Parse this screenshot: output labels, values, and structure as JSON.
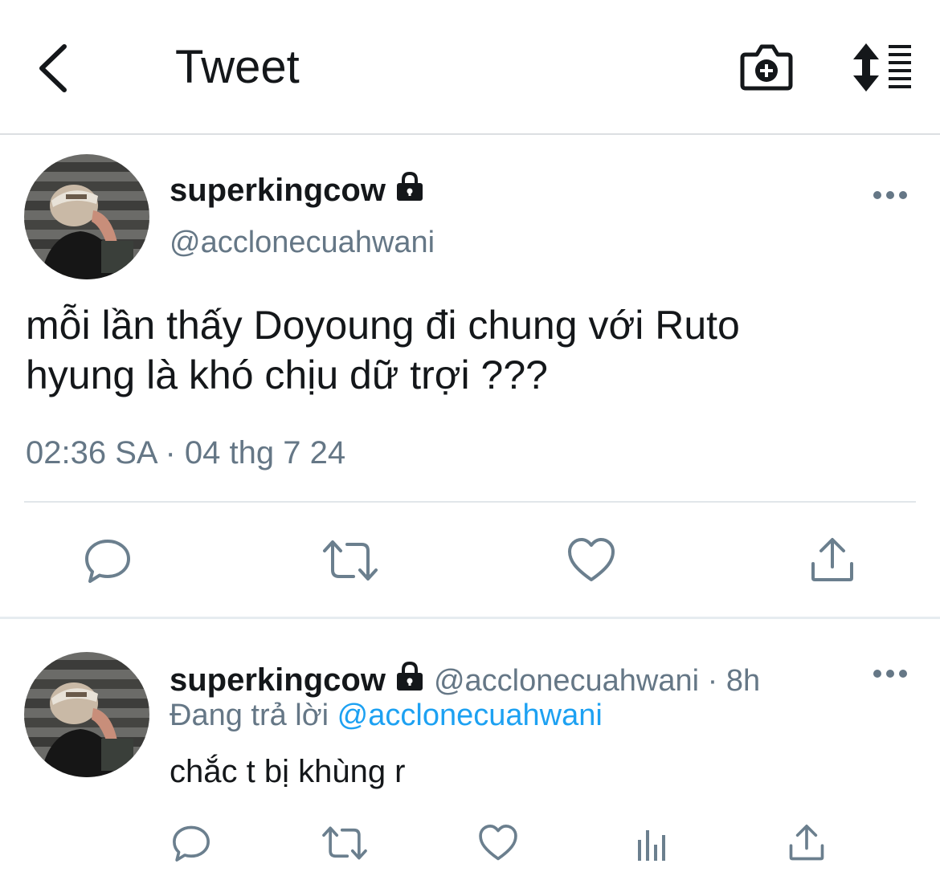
{
  "nav": {
    "title": "Tweet"
  },
  "tweet": {
    "display_name": "superkingcow",
    "handle": "@acclonecuahwani",
    "text_line1": "mỗi lần thấy Doyoung đi chung với Ruto",
    "text_line2": "hyung là khó chịu dữ trợi ???",
    "timestamp": "02:36 SA · 04 thg 7 24",
    "actions": [
      "reply-icon",
      "retweet-icon",
      "like-icon",
      "share-icon"
    ]
  },
  "reply": {
    "display_name": "superkingcow",
    "handle_time": "@acclonecuahwani · 8h",
    "replying_label": "Đang trả lời",
    "replying_to": "@acclonecuahwani",
    "text": "chắc t bị khùng r",
    "actions": [
      "reply-icon",
      "retweet-icon",
      "like-icon",
      "analytics-icon",
      "share-icon"
    ]
  },
  "colors": {
    "text": "#14171a",
    "secondary": "#657786",
    "accent": "#1da1f2",
    "icon": "#6b7f8e"
  }
}
